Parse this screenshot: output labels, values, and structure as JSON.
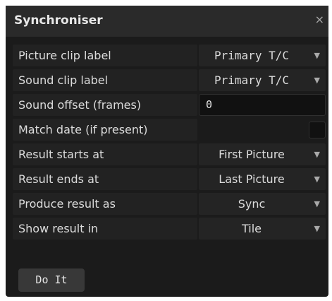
{
  "window": {
    "title": "Synchroniser",
    "close_symbol": "×"
  },
  "rows": [
    {
      "label": "Picture clip label",
      "value": "Primary T/C",
      "control": "select"
    },
    {
      "label": "Sound clip label",
      "value": "Primary T/C",
      "control": "select"
    },
    {
      "label": "Sound offset (frames)",
      "value": "0",
      "control": "input"
    },
    {
      "label": "Match date (if present)",
      "control": "checkbox",
      "checked": false
    },
    {
      "label": "Result starts at",
      "value": "First Picture",
      "control": "select"
    },
    {
      "label": "Result ends at",
      "value": "Last Picture",
      "control": "select"
    },
    {
      "label": "Produce result as",
      "value": "Sync",
      "control": "select"
    },
    {
      "label": "Show result in",
      "value": "Tile",
      "control": "select"
    }
  ],
  "actions": {
    "do_it_label": "Do It"
  },
  "icons": {
    "dropdown": "▼",
    "close": "close-icon",
    "dropdown_icon": "chevron-down-icon"
  },
  "colors": {
    "background": "#1b1b1b",
    "text": "#dcdcdc",
    "input_bg": "#111111",
    "button_bg": "#383838"
  }
}
